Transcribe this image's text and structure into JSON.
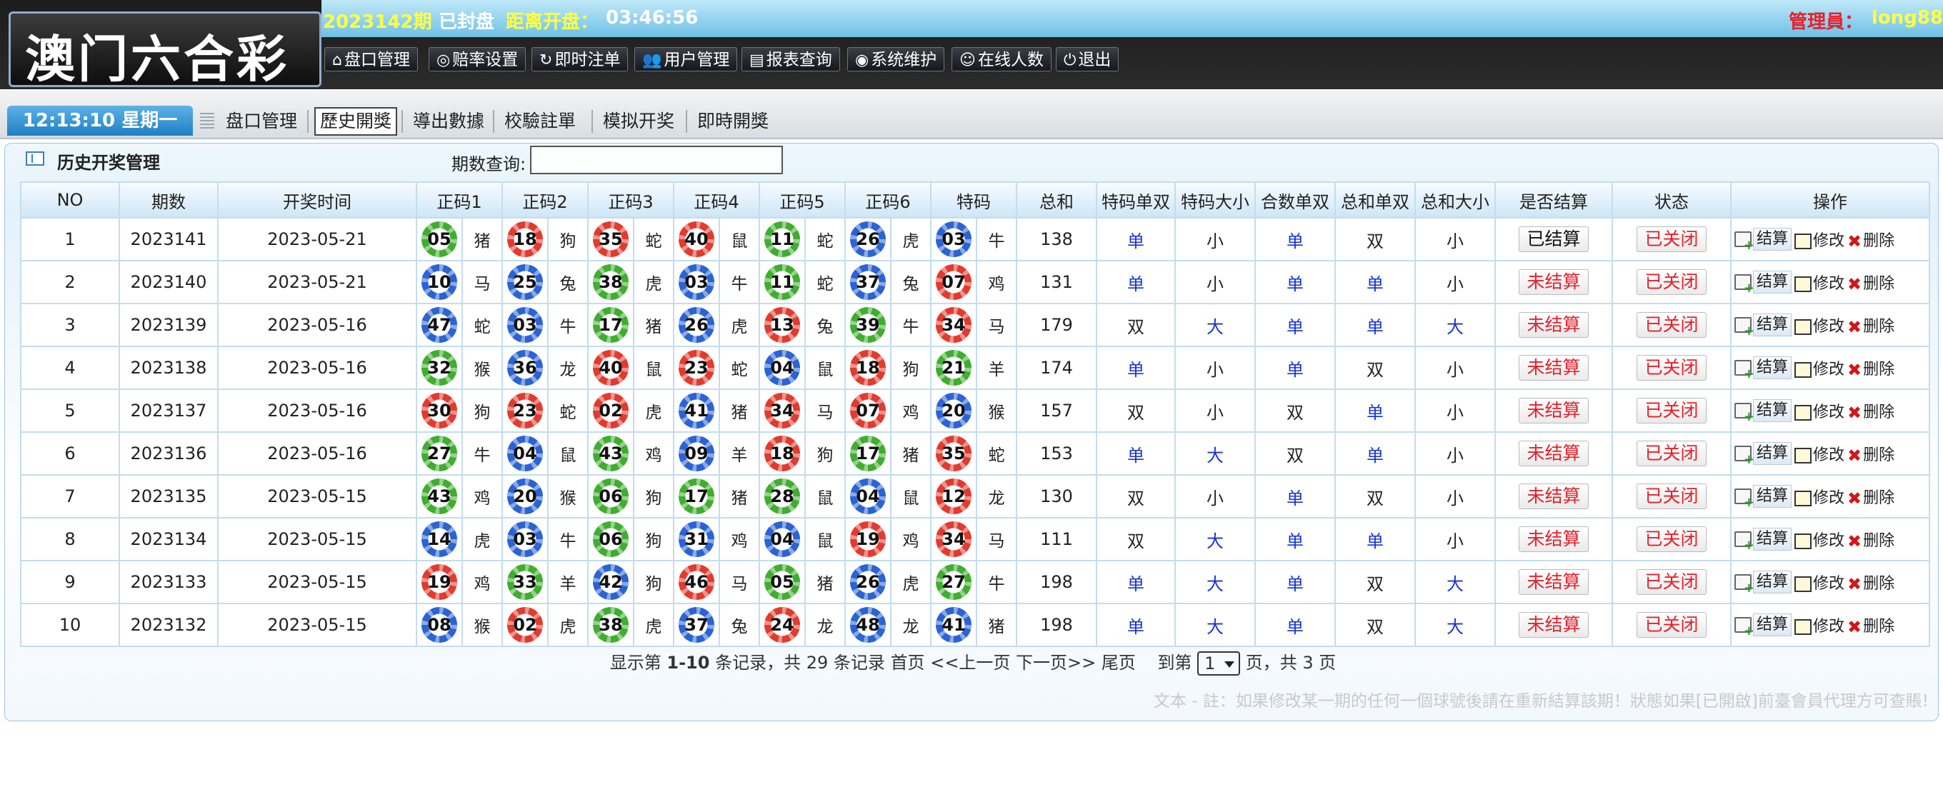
{
  "header": {
    "logo_text": "澳门六合彩",
    "period": "2023142期",
    "status": "已封盘",
    "countdown_label": "距离开盘：",
    "countdown": "03:46:56",
    "admin_label": "管理員：",
    "admin_name": "long88"
  },
  "nav": [
    {
      "icon": "home-icon",
      "glyph": "⌂",
      "label": "盘口管理"
    },
    {
      "icon": "target-icon",
      "glyph": "◎",
      "label": "赔率设置"
    },
    {
      "icon": "refresh-icon",
      "glyph": "↻",
      "label": "即时注单"
    },
    {
      "icon": "users-icon",
      "glyph": "👥",
      "label": "用户管理"
    },
    {
      "icon": "report-icon",
      "glyph": "▤",
      "label": "报表查询"
    },
    {
      "icon": "signal-icon",
      "glyph": "◉",
      "label": "系统维护"
    },
    {
      "icon": "smile-icon",
      "glyph": "☺",
      "label": "在线人数"
    },
    {
      "icon": "power-icon",
      "glyph": "⏻",
      "label": "退出"
    }
  ],
  "clock": "12:13:10 星期一",
  "tabs": [
    {
      "label": "盘口管理",
      "active": false
    },
    {
      "label": "歷史開獎",
      "active": true
    },
    {
      "label": "導出數據",
      "active": false
    },
    {
      "label": "校驗註單",
      "active": false
    },
    {
      "label": "模拟开奖",
      "active": false
    },
    {
      "label": "即時開獎",
      "active": false
    }
  ],
  "panel": {
    "title": "历史开奖管理",
    "query_label": "期数查询:",
    "query_value": ""
  },
  "table": {
    "columns": [
      "NO",
      "期数",
      "开奖时间",
      "正码1",
      "正码2",
      "正码3",
      "正码4",
      "正码5",
      "正码6",
      "特码",
      "总和",
      "特码单双",
      "特码大小",
      "合数单双",
      "总和单双",
      "总和大小",
      "是否结算",
      "状态",
      "操作"
    ],
    "ops": {
      "settle": "结算",
      "edit": "修改",
      "delete": "删除"
    },
    "rows": [
      {
        "no": "1",
        "period": "2023141",
        "date": "2023-05-21",
        "balls": [
          {
            "n": "05",
            "c": "green",
            "z": "猪"
          },
          {
            "n": "18",
            "c": "red",
            "z": "狗"
          },
          {
            "n": "35",
            "c": "red",
            "z": "蛇"
          },
          {
            "n": "40",
            "c": "red",
            "z": "鼠"
          },
          {
            "n": "11",
            "c": "green",
            "z": "蛇"
          },
          {
            "n": "26",
            "c": "blue",
            "z": "虎"
          },
          {
            "n": "03",
            "c": "blue",
            "z": "牛"
          }
        ],
        "sum": "138",
        "s_ds": "单",
        "s_dx": "小",
        "h_ds": "单",
        "t_ds": "双",
        "t_dx": "小",
        "settled": "已结算",
        "state": "已关闭"
      },
      {
        "no": "2",
        "period": "2023140",
        "date": "2023-05-21",
        "balls": [
          {
            "n": "10",
            "c": "blue",
            "z": "马"
          },
          {
            "n": "25",
            "c": "blue",
            "z": "兔"
          },
          {
            "n": "38",
            "c": "green",
            "z": "虎"
          },
          {
            "n": "03",
            "c": "blue",
            "z": "牛"
          },
          {
            "n": "11",
            "c": "green",
            "z": "蛇"
          },
          {
            "n": "37",
            "c": "blue",
            "z": "兔"
          },
          {
            "n": "07",
            "c": "red",
            "z": "鸡"
          }
        ],
        "sum": "131",
        "s_ds": "单",
        "s_dx": "小",
        "h_ds": "单",
        "t_ds": "单",
        "t_dx": "小",
        "settled": "未结算",
        "state": "已关闭"
      },
      {
        "no": "3",
        "period": "2023139",
        "date": "2023-05-16",
        "balls": [
          {
            "n": "47",
            "c": "blue",
            "z": "蛇"
          },
          {
            "n": "03",
            "c": "blue",
            "z": "牛"
          },
          {
            "n": "17",
            "c": "green",
            "z": "猪"
          },
          {
            "n": "26",
            "c": "blue",
            "z": "虎"
          },
          {
            "n": "13",
            "c": "red",
            "z": "兔"
          },
          {
            "n": "39",
            "c": "green",
            "z": "牛"
          },
          {
            "n": "34",
            "c": "red",
            "z": "马"
          }
        ],
        "sum": "179",
        "s_ds": "双",
        "s_dx": "大",
        "h_ds": "单",
        "t_ds": "单",
        "t_dx": "大",
        "settled": "未结算",
        "state": "已关闭"
      },
      {
        "no": "4",
        "period": "2023138",
        "date": "2023-05-16",
        "balls": [
          {
            "n": "32",
            "c": "green",
            "z": "猴"
          },
          {
            "n": "36",
            "c": "blue",
            "z": "龙"
          },
          {
            "n": "40",
            "c": "red",
            "z": "鼠"
          },
          {
            "n": "23",
            "c": "red",
            "z": "蛇"
          },
          {
            "n": "04",
            "c": "blue",
            "z": "鼠"
          },
          {
            "n": "18",
            "c": "red",
            "z": "狗"
          },
          {
            "n": "21",
            "c": "green",
            "z": "羊"
          }
        ],
        "sum": "174",
        "s_ds": "单",
        "s_dx": "小",
        "h_ds": "单",
        "t_ds": "双",
        "t_dx": "小",
        "settled": "未结算",
        "state": "已关闭"
      },
      {
        "no": "5",
        "period": "2023137",
        "date": "2023-05-16",
        "balls": [
          {
            "n": "30",
            "c": "red",
            "z": "狗"
          },
          {
            "n": "23",
            "c": "red",
            "z": "蛇"
          },
          {
            "n": "02",
            "c": "red",
            "z": "虎"
          },
          {
            "n": "41",
            "c": "blue",
            "z": "猪"
          },
          {
            "n": "34",
            "c": "red",
            "z": "马"
          },
          {
            "n": "07",
            "c": "red",
            "z": "鸡"
          },
          {
            "n": "20",
            "c": "blue",
            "z": "猴"
          }
        ],
        "sum": "157",
        "s_ds": "双",
        "s_dx": "小",
        "h_ds": "双",
        "t_ds": "单",
        "t_dx": "小",
        "settled": "未结算",
        "state": "已关闭"
      },
      {
        "no": "6",
        "period": "2023136",
        "date": "2023-05-16",
        "balls": [
          {
            "n": "27",
            "c": "green",
            "z": "牛"
          },
          {
            "n": "04",
            "c": "blue",
            "z": "鼠"
          },
          {
            "n": "43",
            "c": "green",
            "z": "鸡"
          },
          {
            "n": "09",
            "c": "blue",
            "z": "羊"
          },
          {
            "n": "18",
            "c": "red",
            "z": "狗"
          },
          {
            "n": "17",
            "c": "green",
            "z": "猪"
          },
          {
            "n": "35",
            "c": "red",
            "z": "蛇"
          }
        ],
        "sum": "153",
        "s_ds": "单",
        "s_dx": "大",
        "h_ds": "双",
        "t_ds": "单",
        "t_dx": "小",
        "settled": "未结算",
        "state": "已关闭"
      },
      {
        "no": "7",
        "period": "2023135",
        "date": "2023-05-15",
        "balls": [
          {
            "n": "43",
            "c": "green",
            "z": "鸡"
          },
          {
            "n": "20",
            "c": "blue",
            "z": "猴"
          },
          {
            "n": "06",
            "c": "green",
            "z": "狗"
          },
          {
            "n": "17",
            "c": "green",
            "z": "猪"
          },
          {
            "n": "28",
            "c": "green",
            "z": "鼠"
          },
          {
            "n": "04",
            "c": "blue",
            "z": "鼠"
          },
          {
            "n": "12",
            "c": "red",
            "z": "龙"
          }
        ],
        "sum": "130",
        "s_ds": "双",
        "s_dx": "小",
        "h_ds": "单",
        "t_ds": "双",
        "t_dx": "小",
        "settled": "未结算",
        "state": "已关闭"
      },
      {
        "no": "8",
        "period": "2023134",
        "date": "2023-05-15",
        "balls": [
          {
            "n": "14",
            "c": "blue",
            "z": "虎"
          },
          {
            "n": "03",
            "c": "blue",
            "z": "牛"
          },
          {
            "n": "06",
            "c": "green",
            "z": "狗"
          },
          {
            "n": "31",
            "c": "blue",
            "z": "鸡"
          },
          {
            "n": "04",
            "c": "blue",
            "z": "鼠"
          },
          {
            "n": "19",
            "c": "red",
            "z": "鸡"
          },
          {
            "n": "34",
            "c": "red",
            "z": "马"
          }
        ],
        "sum": "111",
        "s_ds": "双",
        "s_dx": "大",
        "h_ds": "单",
        "t_ds": "单",
        "t_dx": "小",
        "settled": "未结算",
        "state": "已关闭"
      },
      {
        "no": "9",
        "period": "2023133",
        "date": "2023-05-15",
        "balls": [
          {
            "n": "19",
            "c": "red",
            "z": "鸡"
          },
          {
            "n": "33",
            "c": "green",
            "z": "羊"
          },
          {
            "n": "42",
            "c": "blue",
            "z": "狗"
          },
          {
            "n": "46",
            "c": "red",
            "z": "马"
          },
          {
            "n": "05",
            "c": "green",
            "z": "猪"
          },
          {
            "n": "26",
            "c": "blue",
            "z": "虎"
          },
          {
            "n": "27",
            "c": "green",
            "z": "牛"
          }
        ],
        "sum": "198",
        "s_ds": "单",
        "s_dx": "大",
        "h_ds": "单",
        "t_ds": "双",
        "t_dx": "大",
        "settled": "未结算",
        "state": "已关闭"
      },
      {
        "no": "10",
        "period": "2023132",
        "date": "2023-05-15",
        "balls": [
          {
            "n": "08",
            "c": "blue",
            "z": "猴"
          },
          {
            "n": "02",
            "c": "red",
            "z": "虎"
          },
          {
            "n": "38",
            "c": "green",
            "z": "虎"
          },
          {
            "n": "37",
            "c": "blue",
            "z": "兔"
          },
          {
            "n": "24",
            "c": "red",
            "z": "龙"
          },
          {
            "n": "48",
            "c": "blue",
            "z": "龙"
          },
          {
            "n": "41",
            "c": "blue",
            "z": "猪"
          }
        ],
        "sum": "198",
        "s_ds": "单",
        "s_dx": "大",
        "h_ds": "单",
        "t_ds": "双",
        "t_dx": "大",
        "settled": "未结算",
        "state": "已关闭"
      }
    ]
  },
  "pager": {
    "prefix": "显示第",
    "range": "1-10",
    "mid": "条记录，共",
    "total": "29",
    "suffix": "条记录",
    "first": "首页",
    "prev": "<<上一页",
    "next": "下一页>>",
    "last": "尾页",
    "goto_label": "到第",
    "page_value": "1",
    "pages_text": "页，共 3 页"
  },
  "note": "文本 - 註：如果修改某一期的任何一個球號後請在重新結算該期！狀態如果[已開啟]前臺會員代理方可查賬!",
  "colors": {
    "accent_blue": "#1f7fc4",
    "header_yellow": "#ffff44",
    "admin_red": "#e8202a",
    "status_red": "#e8202a",
    "value_blue": "#1533d6"
  }
}
